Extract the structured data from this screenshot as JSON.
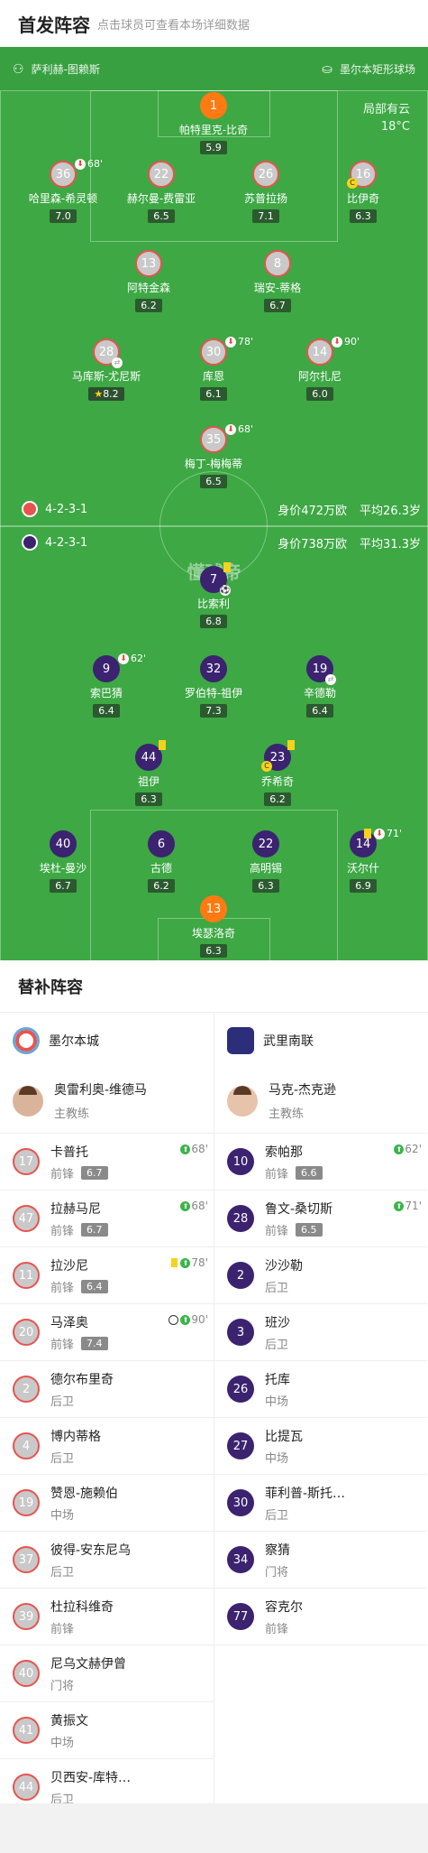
{
  "header": {
    "title": "首发阵容",
    "subtitle": "点击球员可查看本场详细数据"
  },
  "pitch_info": {
    "coach_or_ref": "萨利赫-图赖斯",
    "stadium": "墨尔本矩形球场",
    "weather": "局部有云",
    "temperature": "18°C"
  },
  "home": {
    "formation": "4-2-3-1",
    "value": "身价472万欧",
    "avg_age": "平均26.3岁",
    "players": [
      {
        "num": "1",
        "name": "帕特里克-比奇",
        "rating": "5.9",
        "gk": true
      },
      {
        "num": "36",
        "name": "哈里森-希灵顿",
        "rating": "7.0",
        "sub_min": "68'"
      },
      {
        "num": "22",
        "name": "赫尔曼-费雷亚",
        "rating": "6.5"
      },
      {
        "num": "26",
        "name": "苏普拉扬",
        "rating": "7.1"
      },
      {
        "num": "16",
        "name": "比伊奇",
        "rating": "6.3",
        "captain": true
      },
      {
        "num": "13",
        "name": "阿特金森",
        "rating": "6.2"
      },
      {
        "num": "8",
        "name": "瑞安-蒂格",
        "rating": "6.7"
      },
      {
        "num": "28",
        "name": "马库斯-尤尼斯",
        "rating": "8.2",
        "star": true
      },
      {
        "num": "30",
        "name": "库恩",
        "rating": "6.1",
        "sub_min": "78'"
      },
      {
        "num": "14",
        "name": "阿尔扎尼",
        "rating": "6.0",
        "sub_min": "90'"
      },
      {
        "num": "35",
        "name": "梅丁-梅梅蒂",
        "rating": "6.5",
        "sub_min": "68'"
      }
    ]
  },
  "away": {
    "formation": "4-2-3-1",
    "value": "身价738万欧",
    "avg_age": "平均31.3岁",
    "players": [
      {
        "num": "7",
        "name": "比索利",
        "rating": "6.8"
      },
      {
        "num": "9",
        "name": "索巴猜",
        "rating": "6.4",
        "sub_min": "62'"
      },
      {
        "num": "32",
        "name": "罗伯特-祖伊",
        "rating": "7.3"
      },
      {
        "num": "19",
        "name": "辛德勒",
        "rating": "6.4"
      },
      {
        "num": "44",
        "name": "祖伊",
        "rating": "6.3"
      },
      {
        "num": "23",
        "name": "乔希奇",
        "rating": "6.2",
        "captain": true
      },
      {
        "num": "40",
        "name": "埃杜-曼沙",
        "rating": "6.7"
      },
      {
        "num": "6",
        "name": "古德",
        "rating": "6.2"
      },
      {
        "num": "22",
        "name": "高明锡",
        "rating": "6.3"
      },
      {
        "num": "14",
        "name": "沃尔什",
        "rating": "6.9",
        "sub_min": "71'"
      },
      {
        "num": "13",
        "name": "埃瑟洛奇",
        "rating": "6.3",
        "gk": true
      }
    ]
  },
  "watermark": "懂球帝",
  "subs_title": "替补阵容",
  "home_bench": {
    "team": "墨尔本城",
    "coach_name": "奥雷利奥-维德马",
    "coach_role": "主教练",
    "players": [
      {
        "num": "17",
        "name": "卡普托",
        "pos": "前锋",
        "rating": "6.7",
        "event": "68'"
      },
      {
        "num": "47",
        "name": "拉赫马尼",
        "pos": "前锋",
        "rating": "6.7",
        "event": "68'"
      },
      {
        "num": "11",
        "name": "拉沙尼",
        "pos": "前锋",
        "rating": "6.4",
        "event": "78'",
        "yellow": true
      },
      {
        "num": "20",
        "name": "马泽奥",
        "pos": "前锋",
        "rating": "7.4",
        "event": "90'",
        "goal": true
      },
      {
        "num": "2",
        "name": "德尔布里奇",
        "pos": "后卫"
      },
      {
        "num": "4",
        "name": "博内蒂格",
        "pos": "后卫"
      },
      {
        "num": "19",
        "name": "赞恩-施赖伯",
        "pos": "中场"
      },
      {
        "num": "37",
        "name": "彼得-安东尼乌",
        "pos": "后卫"
      },
      {
        "num": "39",
        "name": "杜拉科维奇",
        "pos": "前锋"
      },
      {
        "num": "40",
        "name": "尼乌文赫伊曾",
        "pos": "门将"
      },
      {
        "num": "41",
        "name": "黄振文",
        "pos": "中场"
      },
      {
        "num": "44",
        "name": "贝西安-库特…",
        "pos": "后卫"
      }
    ]
  },
  "away_bench": {
    "team": "武里南联",
    "coach_name": "马克-杰克逊",
    "coach_role": "主教练",
    "players": [
      {
        "num": "10",
        "name": "索帕那",
        "pos": "前锋",
        "rating": "6.6",
        "event": "62'"
      },
      {
        "num": "28",
        "name": "鲁文-桑切斯",
        "pos": "前锋",
        "rating": "6.5",
        "event": "71'"
      },
      {
        "num": "2",
        "name": "沙沙勒",
        "pos": "后卫"
      },
      {
        "num": "3",
        "name": "班沙",
        "pos": "后卫"
      },
      {
        "num": "26",
        "name": "托库",
        "pos": "中场"
      },
      {
        "num": "27",
        "name": "比提瓦",
        "pos": "中场"
      },
      {
        "num": "30",
        "name": "菲利普-斯托…",
        "pos": "后卫"
      },
      {
        "num": "34",
        "name": "察猜",
        "pos": "门将"
      },
      {
        "num": "77",
        "name": "容克尔",
        "pos": "前锋"
      }
    ]
  },
  "colors": {
    "pitch": "#3da844",
    "away": "#3b2370",
    "gk": "#ff7a12",
    "home_ring": "#e8534f"
  }
}
